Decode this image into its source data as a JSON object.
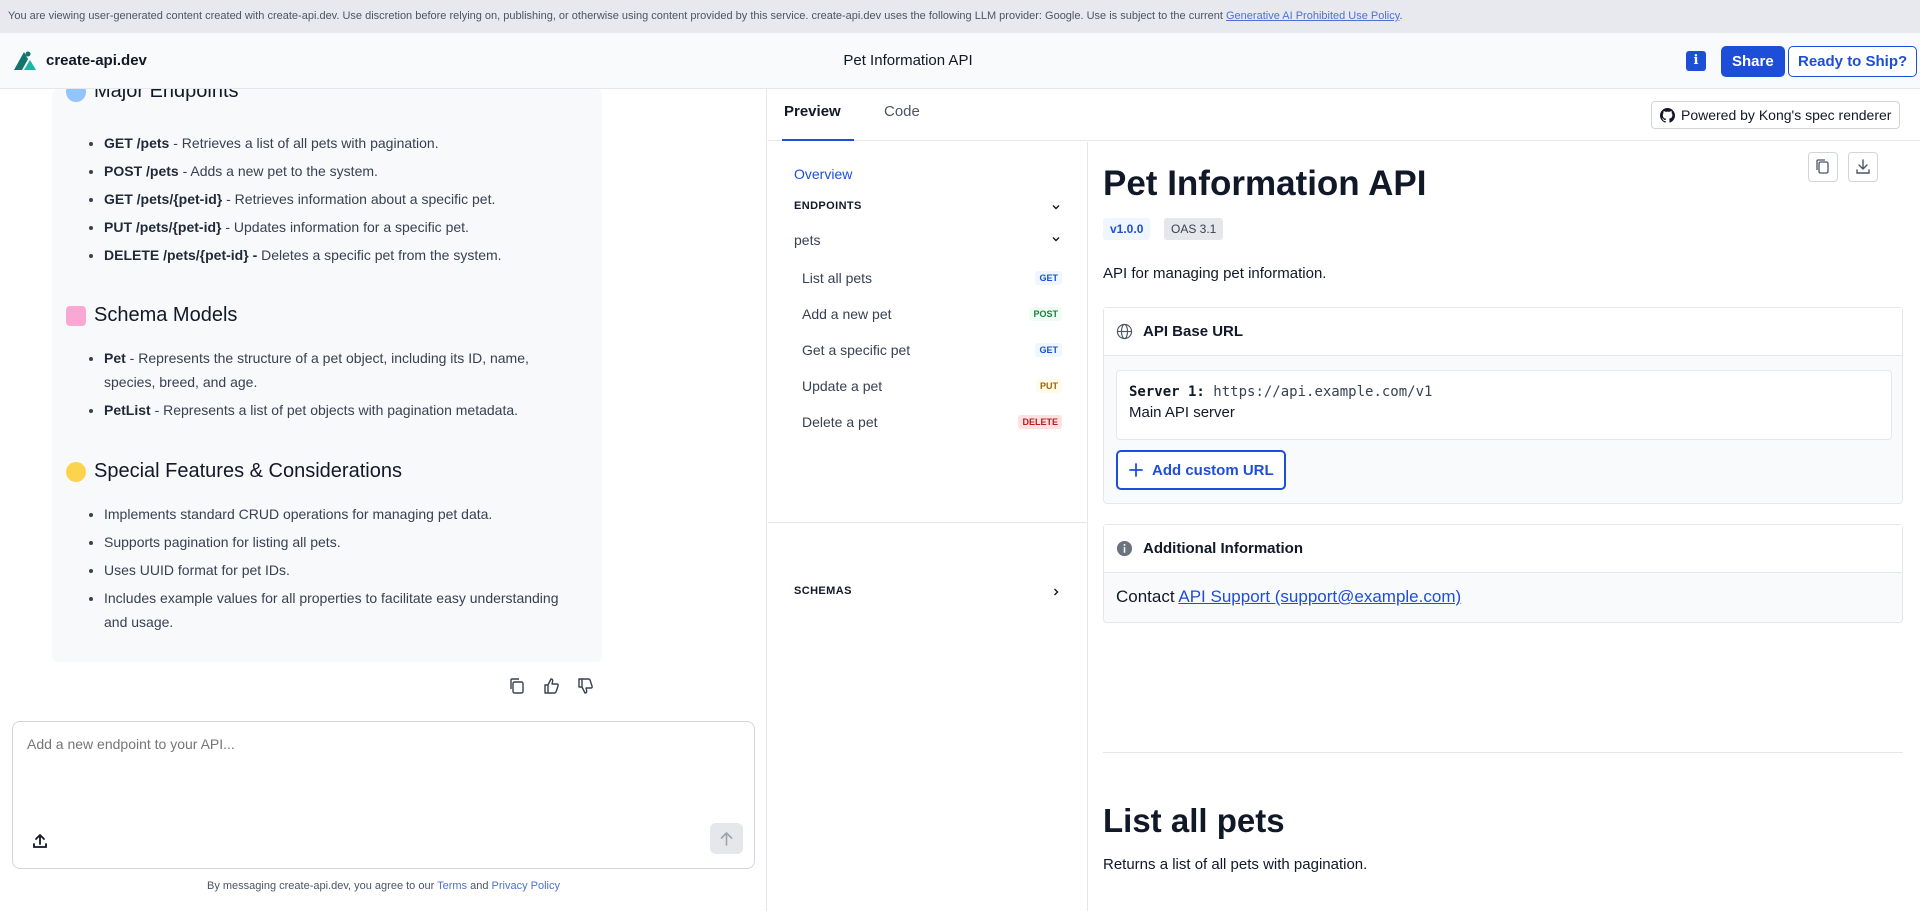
{
  "notice": {
    "text": "You are viewing user-generated content created with create-api.dev. Use discretion before relying on, publishing, or otherwise using content provided by this service. create-api.dev uses the following LLM provider: Google. Use is subject to the current ",
    "link": "Generative AI Prohibited Use Policy",
    "end": "."
  },
  "header": {
    "brand": "create-api.dev",
    "title": "Pet Information API",
    "share": "Share",
    "ship": "Ready to Ship?",
    "feedback_glyph": "i"
  },
  "chat": {
    "sections": [
      {
        "title": "Major Endpoints",
        "items": [
          {
            "bold": "GET /pets",
            "text": " - Retrieves a list of all pets with pagination."
          },
          {
            "bold": "POST /pets",
            "text": " - Adds a new pet to the system."
          },
          {
            "bold": "GET /pets/{pet-id}",
            "text": " - Retrieves information about a specific pet."
          },
          {
            "bold": "PUT /pets/{pet-id}",
            "text": " - Updates information for a specific pet."
          },
          {
            "bold": "DELETE /pets/{pet-id} -",
            "text": " Deletes a specific pet from the system."
          }
        ]
      },
      {
        "title": "Schema Models",
        "items": [
          {
            "bold": "Pet",
            "text": " - Represents the structure of a pet object, including its ID, name, species, breed, and age."
          },
          {
            "bold": "PetList",
            "text": " - Represents a list of pet objects with pagination metadata."
          }
        ]
      },
      {
        "title": "Special Features & Considerations",
        "items": [
          {
            "bold": "",
            "text": "Implements standard CRUD operations for managing pet data."
          },
          {
            "bold": "",
            "text": "Supports pagination for listing all pets."
          },
          {
            "bold": "",
            "text": "Uses UUID format for pet IDs."
          },
          {
            "bold": "",
            "text": "Includes example values for all properties to facilitate easy understanding and usage."
          }
        ]
      }
    ],
    "placeholder": "Add a new endpoint to your API...",
    "legal_prefix": "By messaging create-api.dev, you agree to our ",
    "terms": "Terms",
    "and": " and ",
    "privacy": "Privacy Policy"
  },
  "tabs": {
    "preview": "Preview",
    "code": "Code",
    "kong": "Powered by Kong's spec renderer"
  },
  "nav": {
    "overview": "Overview",
    "endpoints": "ENDPOINTS",
    "group": "pets",
    "items": [
      {
        "label": "List all pets",
        "method": "GET"
      },
      {
        "label": "Add a new pet",
        "method": "POST"
      },
      {
        "label": "Get a specific pet",
        "method": "GET"
      },
      {
        "label": "Update a pet",
        "method": "PUT"
      },
      {
        "label": "Delete a pet",
        "method": "DELETE"
      }
    ],
    "schemas": "SCHEMAS"
  },
  "doc": {
    "title": "Pet Information API",
    "version": "v1.0.0",
    "oas": "OAS 3.1",
    "description": "API for managing pet information.",
    "base_url_title": "API Base URL",
    "server_label": "Server 1:",
    "server_url": "https://api.example.com/v1",
    "server_desc": "Main API server",
    "add_url": "Add custom URL",
    "additional_title": "Additional Information",
    "contact_label": "Contact ",
    "contact_link": "API Support (support@example.com)",
    "op_title": "List all pets",
    "op_desc": "Returns a list of all pets with pagination."
  },
  "colors": {
    "accent": "#1d4ed8",
    "get": "#1d4ed8",
    "post": "#15803d",
    "put": "#a16207",
    "delete": "#b91c1c"
  }
}
